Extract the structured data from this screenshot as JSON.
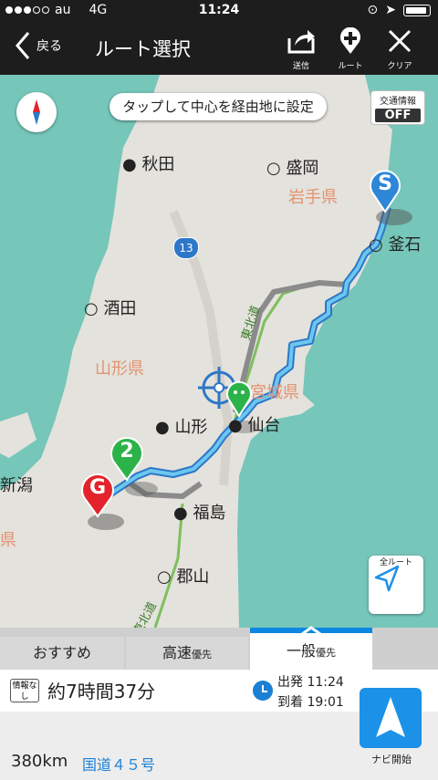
{
  "status_bar": {
    "carrier": "au",
    "network": "4G",
    "time": "11:24"
  },
  "nav": {
    "back_label": "戻る",
    "title": "ルート選択",
    "send_label": "送信",
    "route_label": "ルート",
    "clear_label": "クリア"
  },
  "map": {
    "hint": "タップして中心を経由地に設定",
    "traffic_label": "交通情報",
    "traffic_state": "OFF",
    "all_route_label": "全ルート",
    "highway_shield": "13",
    "expressway_label": "東北道",
    "expressway_label_2": "東北道",
    "start_marker": "S",
    "goal_marker": "G",
    "waypoint_marker": "2",
    "cities": {
      "akita": "秋田",
      "morioka": "盛岡",
      "kamaishi": "釜石",
      "sakata": "酒田",
      "yamagata": "山形",
      "sendai": "仙台",
      "fukushima": "福島",
      "koriyama": "郡山",
      "niigata": "新潟"
    },
    "prefectures": {
      "iwate": "岩手県",
      "yamagata": "山形県",
      "miyagi": "宮城県",
      "other": "県"
    }
  },
  "tabs": [
    {
      "label": "おすすめ",
      "suffix": ""
    },
    {
      "label": "高速",
      "suffix": "優先"
    },
    {
      "label": "一般",
      "suffix": "優先"
    }
  ],
  "route_info": {
    "badge": "情報なし",
    "duration": "約7時間37分",
    "departure": "出発 11:24",
    "arrival": "到着 19:01",
    "distance": "380km",
    "road": "国道４５号",
    "navi_start": "ナビ開始"
  },
  "colors": {
    "sea": "#76c6ba",
    "land": "#e4e2dc",
    "route": "#6cc7ef",
    "accent": "#1c91e8",
    "goal": "#e3232b",
    "start": "#2d86d8",
    "waypoint": "#2bb34a"
  }
}
